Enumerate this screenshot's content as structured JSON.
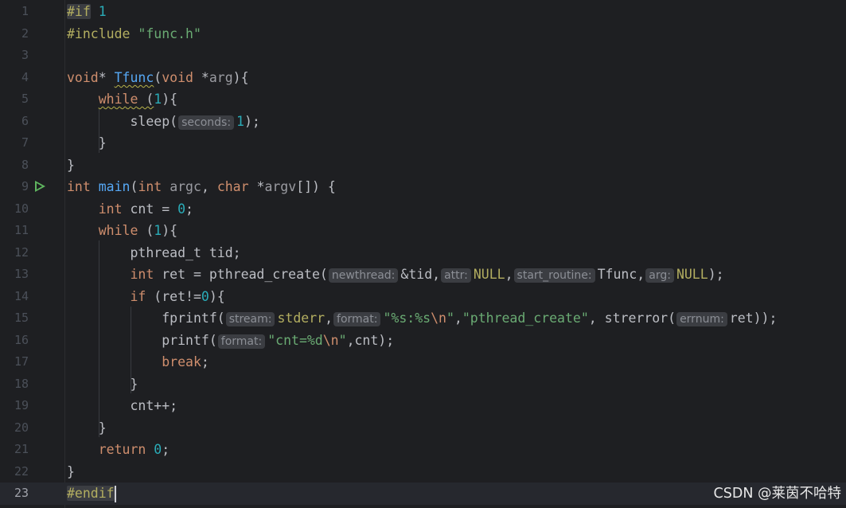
{
  "editor": {
    "line_numbers": [
      "1",
      "2",
      "3",
      "4",
      "5",
      "6",
      "7",
      "8",
      "9",
      "10",
      "11",
      "12",
      "13",
      "14",
      "15",
      "16",
      "17",
      "18",
      "19",
      "20",
      "21",
      "22",
      "23"
    ],
    "current_line": "23"
  },
  "code": {
    "l1": {
      "directive": "#if",
      "value": "1"
    },
    "l2": {
      "directive": "#include",
      "path": "\"func.h\""
    },
    "l4": {
      "ret": "void",
      "star": "* ",
      "name": "Tfunc",
      "open": "(",
      "ptype": "void",
      "pstar": " *",
      "pname": "arg",
      "close": "){"
    },
    "l5": {
      "kw": "while",
      "sp": " (",
      "num": "1",
      "close": "){"
    },
    "l6": {
      "fn": "sleep(",
      "hint": "seconds:",
      "num": "1",
      "close": ");"
    },
    "l7": {
      "text": "}"
    },
    "l8": {
      "text": "}"
    },
    "l9": {
      "type": "int",
      "name": "main",
      "open": "(",
      "t1": "int",
      "p1": "argc",
      "comma": ", ",
      "t2": "char",
      "star": " *",
      "p2": "argv",
      "close": "[]) {"
    },
    "l10": {
      "type": "int",
      "mid": " cnt = ",
      "num": "0",
      "end": ";"
    },
    "l11": {
      "kw": "while",
      "sp": " (",
      "num": "1",
      "close": "){"
    },
    "l12": {
      "text": "pthread_t tid;"
    },
    "l13": {
      "type": "int",
      "mid": " ret = pthread_create(",
      "h1": "newthread:",
      "a1": "&tid,",
      "h2": "attr:",
      "a2": "NULL",
      "c2": ",",
      "h3": "start_routine:",
      "a3": "Tfunc,",
      "h4": "arg:",
      "a4": "NULL",
      "end": ");"
    },
    "l14": {
      "kw": "if",
      "mid": " (ret!=",
      "num": "0",
      "close": "){"
    },
    "l15": {
      "fn": "fprintf(",
      "h1": "stream:",
      "a1": "stderr",
      "c1": ",",
      "h2": "format:",
      "s1": "\"%s:%s",
      "e1": "\\n",
      "s1b": "\"",
      "c2": ",",
      "s2": "\"pthread_create\"",
      "mid": ", strerror(",
      "h3": "errnum:",
      "a3": "ret));"
    },
    "l16": {
      "fn": "printf(",
      "h1": "format:",
      "s1": "\"cnt=%d",
      "e1": "\\n",
      "s1b": "\"",
      "end": ",cnt);"
    },
    "l17": {
      "kw": "break",
      "end": ";"
    },
    "l18": {
      "text": "}"
    },
    "l19": {
      "text": "cnt++;"
    },
    "l20": {
      "text": "}"
    },
    "l21": {
      "kw": "return",
      "sp": " ",
      "num": "0",
      "end": ";"
    },
    "l22": {
      "text": "}"
    },
    "l23": {
      "directive": "#endif"
    }
  },
  "watermark": "CSDN @莱茵不哈特",
  "colors": {
    "background": "#1e1f22",
    "keyword": "#cf8e6d",
    "function": "#56a8f5",
    "string": "#6aab73",
    "number": "#2aacb8",
    "macro": "#b3ae60",
    "run_icon": "#5fb55f"
  },
  "icons": {
    "line9": "run-icon"
  }
}
